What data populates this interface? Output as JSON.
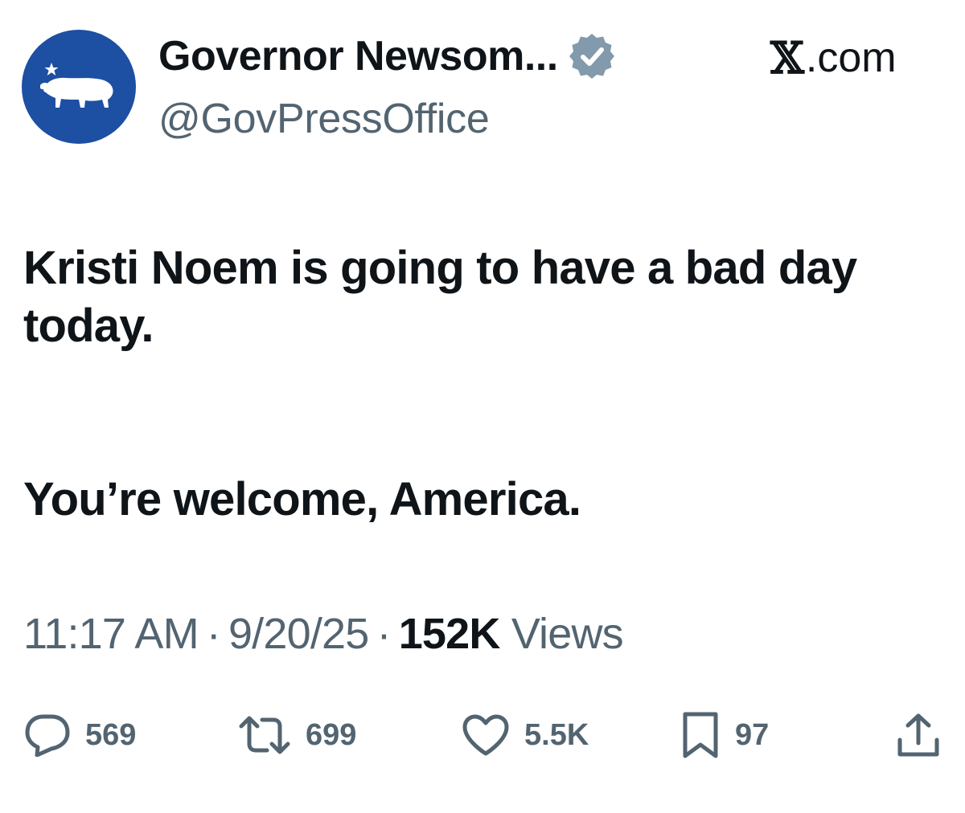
{
  "tweet": {
    "author": {
      "display_name": "Governor Newsom...",
      "handle": "@GovPressOffice",
      "verified_icon": "verified-badge-icon",
      "avatar_icon": "california-bear-icon"
    },
    "source": {
      "x_glyph": "𝕏",
      "label": ".com"
    },
    "text": {
      "paragraph1": "Kristi Noem is going to have a bad day today.",
      "paragraph2": "You’re welcome, America."
    },
    "meta": {
      "time": "11:17 AM",
      "separator": "·",
      "date": "9/20/25",
      "views_count": "152K",
      "views_label": "Views"
    },
    "actions": {
      "replies": "569",
      "reposts": "699",
      "likes": "5.5K",
      "bookmarks": "97",
      "share_icon": "share-icon"
    }
  },
  "colors": {
    "text_primary": "#0f1419",
    "text_secondary": "#536471",
    "avatar_blue": "#1d4fa3",
    "verified_gray": "#829aab"
  }
}
